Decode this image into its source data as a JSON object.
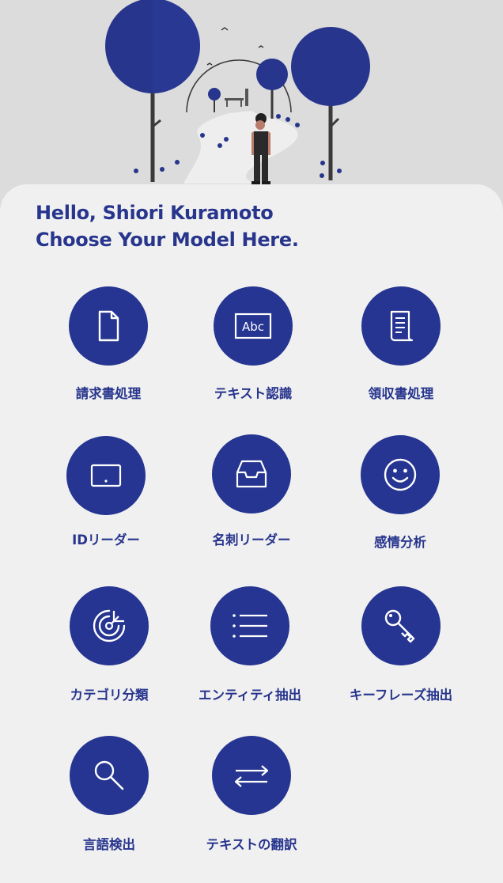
{
  "greeting": {
    "line1": "Hello, Shiori Kuramoto",
    "line2": "Choose Your Model Here."
  },
  "models": [
    {
      "label": "請求書処理",
      "icon": "document-icon",
      "icon_text": ""
    },
    {
      "label": "テキスト認識",
      "icon": "text-abc-icon",
      "icon_text": "Abc"
    },
    {
      "label": "領収書処理",
      "icon": "receipt-icon",
      "icon_text": ""
    },
    {
      "label": "IDリーダー",
      "icon": "id-card-icon",
      "icon_text": ""
    },
    {
      "label": "名刺リーダー",
      "icon": "inbox-tray-icon",
      "icon_text": ""
    },
    {
      "label": "感情分析",
      "icon": "smiley-icon",
      "icon_text": ""
    },
    {
      "label": "カテゴリ分類",
      "icon": "target-icon",
      "icon_text": ""
    },
    {
      "label": "エンティティ抽出",
      "icon": "list-icon",
      "icon_text": ""
    },
    {
      "label": "キーフレーズ抽出",
      "icon": "key-icon",
      "icon_text": ""
    },
    {
      "label": "言語検出",
      "icon": "search-icon",
      "icon_text": ""
    },
    {
      "label": "テキストの翻訳",
      "icon": "swap-arrows-icon",
      "icon_text": ""
    }
  ],
  "colors": {
    "accent": "#253591",
    "heading": "#27358d",
    "background": "#f0f0f0",
    "hero_background": "#dcdcdc"
  }
}
